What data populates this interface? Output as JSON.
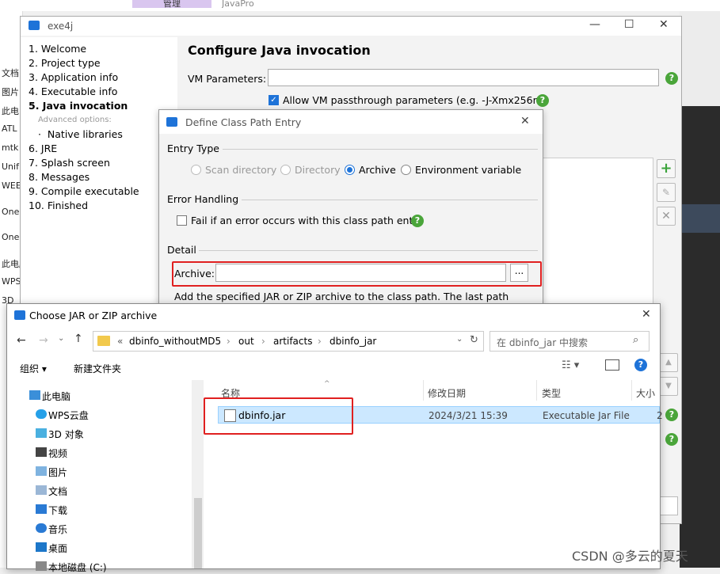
{
  "background": {
    "tab_manage": "管理",
    "tab_javapro": "JavaPro",
    "left_items": [
      "文档",
      "图片",
      "此电",
      "ATL",
      "mtk",
      "Unif",
      "WEE",
      "OneD",
      "OneD",
      "此电脑",
      "WPS",
      "3D"
    ]
  },
  "exe4j": {
    "title": "exe4j",
    "steps": [
      "1. Welcome",
      "2. Project type",
      "3. Application info",
      "4. Executable info",
      "5. Java invocation",
      "Advanced options:",
      "Native libraries",
      "6. JRE",
      "7. Splash screen",
      "8. Messages",
      "9. Compile executable",
      "10. Finished"
    ],
    "active_step": "5. Java invocation",
    "heading": "Configure Java invocation",
    "vm_params_label": "VM Parameters:",
    "vm_params_value": "",
    "allow_passthrough_label": "Allow VM passthrough parameters (e.g. -J-Xmx256m)",
    "allow_passthrough_checked": true,
    "help_glyph": "?"
  },
  "define_entry": {
    "title": "Define Class Path Entry",
    "entry_type_label": "Entry Type",
    "options": [
      "Scan directory",
      "Directory",
      "Archive",
      "Environment variable"
    ],
    "selected_option": "Archive",
    "error_handling_label": "Error Handling",
    "fail_label": "Fail if an error occurs with this class path entry",
    "detail_label": "Detail",
    "archive_label": "Archive:",
    "archive_value": "",
    "browse_label": "...",
    "description": "Add the specified JAR or ZIP archive to the class path. The last path"
  },
  "chooser": {
    "title": "Choose JAR or ZIP archive",
    "breadcrumb": [
      "«",
      "dbinfo_withoutMD5",
      "out",
      "artifacts",
      "dbinfo_jar"
    ],
    "search_placeholder": "在 dbinfo_jar 中搜索",
    "organize_label": "组织 ▾",
    "new_folder_label": "新建文件夹",
    "nav_items": [
      "此电脑",
      "WPS云盘",
      "3D 对象",
      "视频",
      "图片",
      "文档",
      "下载",
      "音乐",
      "桌面",
      "本地磁盘 (C:)"
    ],
    "columns": [
      "名称",
      "修改日期",
      "类型",
      "大小"
    ],
    "files": [
      {
        "name": "dbinfo.jar",
        "modified": "2024/3/21 15:39",
        "type": "Executable Jar File",
        "size": "2"
      }
    ]
  },
  "watermark": "CSDN @多云的夏天",
  "colors": {
    "accent": "#1e73d8",
    "highlight": "#e02020",
    "help": "#4aa53a",
    "selection": "#cce8ff"
  }
}
